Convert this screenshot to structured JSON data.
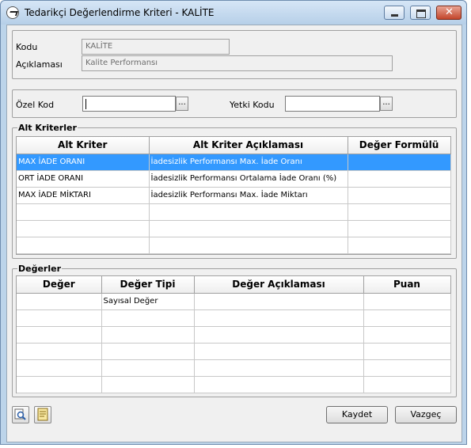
{
  "window": {
    "title": "Tedarikçi Değerlendirme Kriteri - KALİTE"
  },
  "header": {
    "kodu_label": "Kodu",
    "kodu_value": "KALİTE",
    "aciklama_label": "Açıklaması",
    "aciklama_value": "Kalite Performansı"
  },
  "filters": {
    "ozel_kod_label": "Özel Kod",
    "ozel_kod_value": "",
    "yetki_kodu_label": "Yetki Kodu",
    "yetki_kodu_value": "",
    "lookup_label": "..."
  },
  "alt_kriterler": {
    "legend": "Alt Kriterler",
    "columns": [
      "Alt Kriter",
      "Alt Kriter Açıklaması",
      "Değer Formülü"
    ],
    "rows": [
      [
        "MAX İADE ORANI",
        "İadesizlik Performansı Max. İade Oranı",
        ""
      ],
      [
        "ORT İADE ORANI",
        "İadesizlik Performansı Ortalama İade Oranı (%)",
        ""
      ],
      [
        "MAX İADE MİKTARI",
        "İadesizlik Performansı Max. İade Miktarı",
        ""
      ],
      [
        "",
        "",
        ""
      ],
      [
        "",
        "",
        ""
      ],
      [
        "",
        "",
        ""
      ]
    ],
    "selected_row": 0
  },
  "degerler": {
    "legend": "Değerler",
    "columns": [
      "Değer",
      "Değer Tipi",
      "Değer Açıklaması",
      "Puan"
    ],
    "rows": [
      [
        "",
        "Sayısal Değer",
        "",
        ""
      ],
      [
        "",
        "",
        "",
        ""
      ],
      [
        "",
        "",
        "",
        ""
      ],
      [
        "",
        "",
        "",
        ""
      ],
      [
        "",
        "",
        "",
        ""
      ],
      [
        "",
        "",
        "",
        ""
      ]
    ]
  },
  "footer": {
    "kaydet_label": "Kaydet",
    "vazgec_label": "Vazgeç",
    "tool_icons": [
      "search-icon",
      "document-icon"
    ]
  },
  "colors": {
    "selection": "#3399ff",
    "titlebar": "#b6cfe8"
  }
}
